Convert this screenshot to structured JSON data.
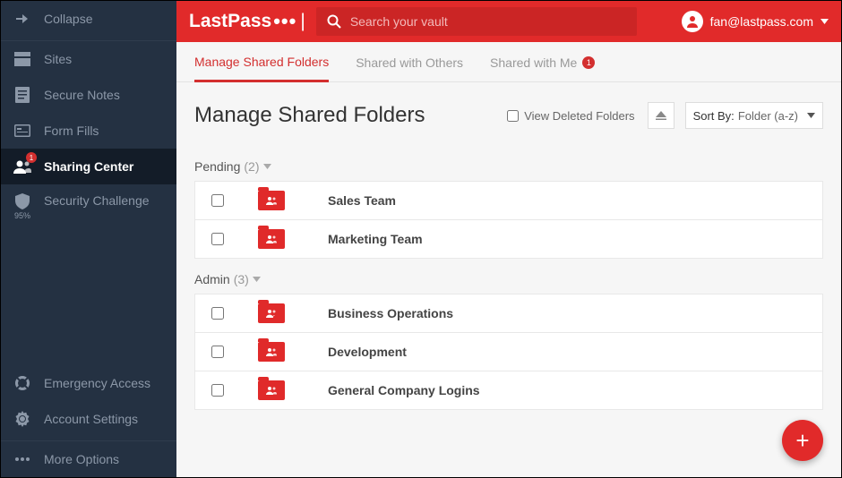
{
  "brand": {
    "name": "LastPass"
  },
  "search": {
    "placeholder": "Search your vault"
  },
  "user": {
    "email": "fan@lastpass.com"
  },
  "sidebar": {
    "items": [
      {
        "label": "Collapse"
      },
      {
        "label": "Sites"
      },
      {
        "label": "Secure Notes"
      },
      {
        "label": "Form Fills"
      },
      {
        "label": "Sharing Center",
        "badge": "1"
      },
      {
        "label": "Security Challenge",
        "sub": "95%"
      }
    ],
    "bottom": [
      {
        "label": "Emergency Access"
      },
      {
        "label": "Account Settings"
      },
      {
        "label": "More Options"
      }
    ]
  },
  "tabs": [
    {
      "label": "Manage Shared Folders"
    },
    {
      "label": "Shared with Others"
    },
    {
      "label": "Shared with Me",
      "badge": "1"
    }
  ],
  "page": {
    "title": "Manage Shared Folders",
    "viewDeleted": "View Deleted Folders",
    "sortLabel": "Sort By:",
    "sortValue": "Folder (a-z)"
  },
  "sections": [
    {
      "name": "Pending",
      "count": "(2)",
      "rows": [
        "Sales Team",
        "Marketing Team"
      ]
    },
    {
      "name": "Admin",
      "count": "(3)",
      "rows": [
        "Business Operations",
        "Development",
        "General Company Logins"
      ]
    }
  ]
}
